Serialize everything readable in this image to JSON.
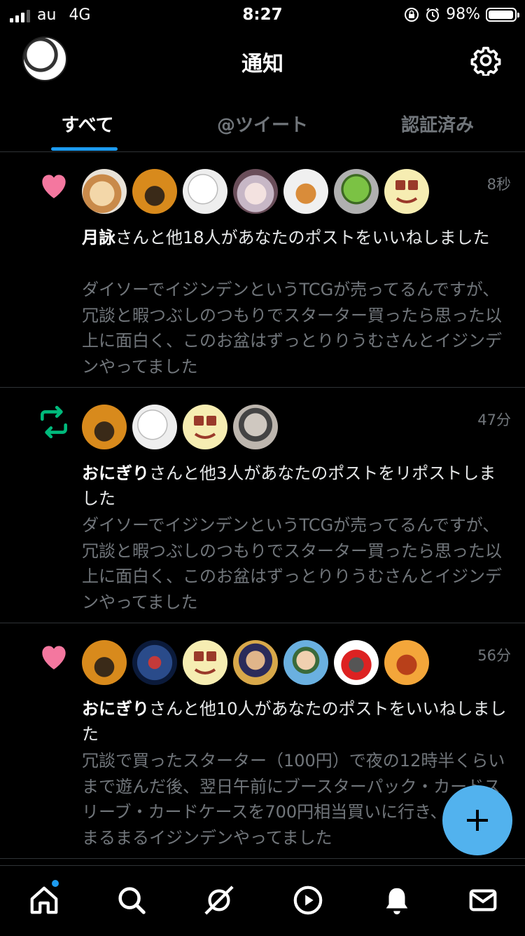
{
  "status_bar": {
    "carrier": "au",
    "network": "4G",
    "time": "8:27",
    "battery": "98%",
    "battery_level": 0.98
  },
  "header": {
    "title": "通知"
  },
  "tabs": [
    {
      "label": "すべて",
      "active": true
    },
    {
      "label": "@ツイート",
      "active": false
    },
    {
      "label": "認証済み",
      "active": false
    }
  ],
  "notifications": [
    {
      "type": "like",
      "time": "8秒",
      "actor": "月詠",
      "action": "さんと他18人があなたのポストをいいねしました",
      "snippet": "ダイソーでイジンデンというTCGが売ってるんですが、冗談と暇つぶしのつもりでスターター買ったら思った以上に面白く、このお盆はずっとりりうむさんとイジンデンやってました"
    },
    {
      "type": "repost",
      "time": "47分",
      "actor": "おにぎり",
      "action": "さんと他3人があなたのポストをリポストしました",
      "snippet": "ダイソーでイジンデンというTCGが売ってるんですが、冗談と暇つぶしのつもりでスターター買ったら思った以上に面白く、このお盆はずっとりりうむさんとイジンデンやってました"
    },
    {
      "type": "like",
      "time": "56分",
      "actor": "おにぎり",
      "action": "さんと他10人があなたのポストをいいねしました",
      "snippet": "冗談で買ったスターター（100円）で夜の12時半くらいまで遊んだ後、翌日午前にブースターパック・カードスリーブ・カードケースを700円相当買いに行き、午後はまるまるイジンデンやってました"
    }
  ],
  "colors": {
    "like": "#f4779f",
    "repost": "#00ba7c",
    "accent": "#1d9bf0",
    "fab": "#52b2ee"
  },
  "icons": [
    "home-icon",
    "search-icon",
    "spaces-icon",
    "video-icon",
    "notifications-icon",
    "messages-icon"
  ]
}
